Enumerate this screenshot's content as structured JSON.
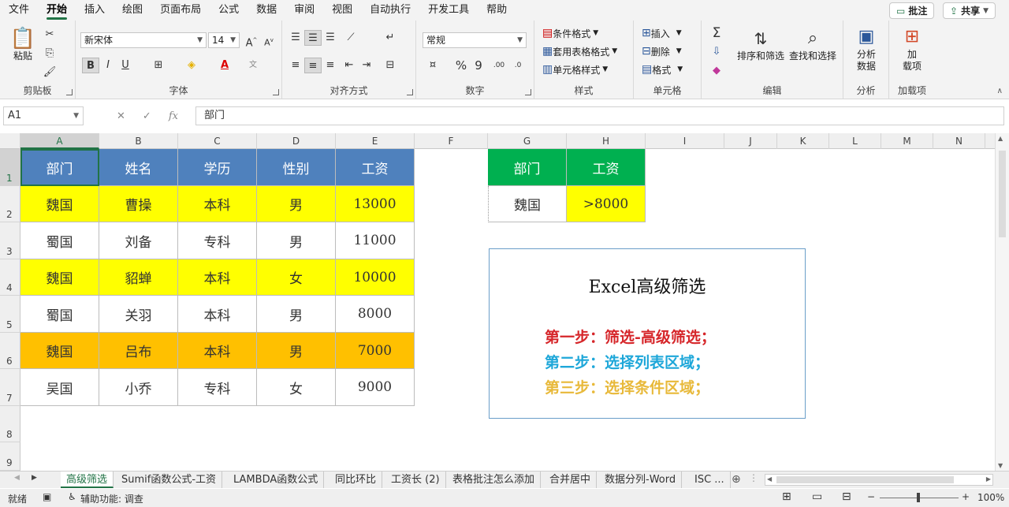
{
  "menu": [
    "文件",
    "开始",
    "插入",
    "绘图",
    "页面布局",
    "公式",
    "数据",
    "审阅",
    "视图",
    "自动执行",
    "开发工具",
    "帮助"
  ],
  "menu_active_index": 1,
  "top_buttons": {
    "comment": "批注",
    "share": "共享"
  },
  "ribbon": {
    "clipboard": {
      "label": "剪贴板",
      "paste": "粘贴"
    },
    "font": {
      "label": "字体",
      "font_name": "新宋体",
      "font_size": "14",
      "bold": "B",
      "italic": "I",
      "underline": "U"
    },
    "align": {
      "label": "对齐方式"
    },
    "number": {
      "label": "数字",
      "format": "常规"
    },
    "styles": {
      "label": "样式",
      "cond_format": "条件格式",
      "table_format": "套用表格格式",
      "cell_style": "单元格样式"
    },
    "cells": {
      "label": "单元格",
      "insert": "插入",
      "delete": "删除",
      "format": "格式"
    },
    "editing": {
      "label": "编辑",
      "sort": "排序和筛选",
      "find": "查找和选择"
    },
    "analysis": {
      "label": "分析",
      "button": "分析\n数据"
    },
    "addins": {
      "label": "加载项",
      "button": "加\n载项"
    }
  },
  "formula_bar": {
    "name_box": "A1",
    "fx": "fx",
    "value": "部门"
  },
  "columns": [
    "A",
    "B",
    "C",
    "D",
    "E",
    "F",
    "G",
    "H",
    "I",
    "J",
    "K",
    "L",
    "M",
    "N"
  ],
  "rows": [
    "1",
    "2",
    "3",
    "4",
    "5",
    "6",
    "7",
    "8",
    "9"
  ],
  "table": {
    "headers": [
      "部门",
      "姓名",
      "学历",
      "性别",
      "工资"
    ],
    "rows": [
      [
        "魏国",
        "曹操",
        "本科",
        "男",
        "13000"
      ],
      [
        "蜀国",
        "刘备",
        "专科",
        "男",
        "11000"
      ],
      [
        "魏国",
        "貂蝉",
        "本科",
        "女",
        "10000"
      ],
      [
        "蜀国",
        "关羽",
        "本科",
        "男",
        "8000"
      ],
      [
        "魏国",
        "吕布",
        "本科",
        "男",
        "7000"
      ],
      [
        "吴国",
        "小乔",
        "专科",
        "女",
        "9000"
      ]
    ],
    "row_colors": [
      "#ffff00",
      "#ffffff",
      "#ffff00",
      "#ffffff",
      "#ffc000",
      "#ffffff"
    ]
  },
  "criteria": {
    "headers": [
      "部门",
      "工资"
    ],
    "values": [
      "魏国",
      ">8000"
    ]
  },
  "info_box": {
    "title": "Excel高级筛选",
    "step1": "第一步：筛选-高级筛选；",
    "step2": "第二步：选择列表区域；",
    "step3": "第三步：选择条件区域；",
    "colors": {
      "step1": "#d6262a",
      "step2": "#1ea7d9",
      "step3": "#e8b93a"
    }
  },
  "sheet_tabs": [
    "高级筛选",
    "Sumif函数公式-工资",
    "LAMBDA函数公式",
    "同比环比",
    "工资长 (2)",
    "表格批注怎么添加",
    "合并居中",
    "数据分列-Word",
    "ISC ..."
  ],
  "status": {
    "ready": "就绪",
    "accessibility": "辅助功能: 调查",
    "zoom": "100%"
  },
  "colors": {
    "accent": "#217346",
    "header_blue": "#4f81bd",
    "header_green": "#00b050"
  }
}
